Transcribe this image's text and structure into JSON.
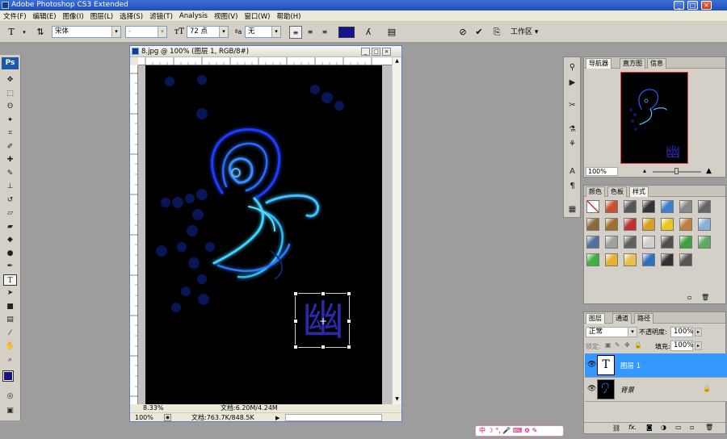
{
  "app": {
    "title": "Adobe Photoshop CS3 Extended"
  },
  "menu": [
    "文件(F)",
    "编辑(E)",
    "图像(I)",
    "图层(L)",
    "选择(S)",
    "滤镜(T)",
    "Analysis",
    "视图(V)",
    "窗口(W)",
    "帮助(H)"
  ],
  "options": {
    "font_family": "宋体",
    "font_style": "-",
    "font_size": "72 点",
    "antialias_label": "ªa",
    "antialias": "无",
    "workspace": "工作区 ▾",
    "text_color": "#14148c"
  },
  "tools": [
    "move",
    "marquee",
    "lasso",
    "magic-wand",
    "crop",
    "slice",
    "healing",
    "brush",
    "stamp",
    "history-brush",
    "eraser",
    "gradient",
    "blur",
    "dodge",
    "pen",
    "type",
    "path-select",
    "shape",
    "notes",
    "eyedropper",
    "hand",
    "zoom"
  ],
  "document": {
    "title": "8.jpg @ 100% (图层 1, RGB/8#)",
    "zoom1": "8.33%",
    "docsize1": "文档:6.20M/4.24M",
    "zoom2": "100%",
    "docsize2": "文档:763.7K/848.5K",
    "text_glyph": "幽"
  },
  "navigator": {
    "tabs": [
      "导航器",
      "直方图",
      "信息"
    ],
    "zoom": "100%"
  },
  "styles": {
    "tabs": [
      "颜色",
      "色板",
      "样式"
    ],
    "swatches": [
      "#ffffff",
      "#c8502a",
      "#555555",
      "#333333",
      "#3a7fd0",
      "#888888",
      "#666666",
      "#8a6a3a",
      "#a07030",
      "#c03030",
      "#d8a020",
      "#e8c820",
      "#c08040",
      "#8ab0d8",
      "#5070a0",
      "#a0a0a0",
      "#606060",
      "#d0d0d0",
      "#505050",
      "#40a040",
      "#60a860",
      "#40b040",
      "#e8b030",
      "#e8c050",
      "#3070c0",
      "#303030",
      "#555555"
    ]
  },
  "layers": {
    "tabs": [
      "图层",
      "通道",
      "路径"
    ],
    "blend_mode": "正常",
    "opacity_label": "不透明度:",
    "opacity": "100%",
    "lock_label": "锁定:",
    "fill_label": "填充:",
    "fill": "100%",
    "items": [
      {
        "name": "图层 1",
        "type": "text"
      },
      {
        "name": "背景",
        "type": "image"
      }
    ]
  },
  "ime": {
    "text": "中 ☽ °, 🎤 ⌨ ⚙ ✎"
  }
}
